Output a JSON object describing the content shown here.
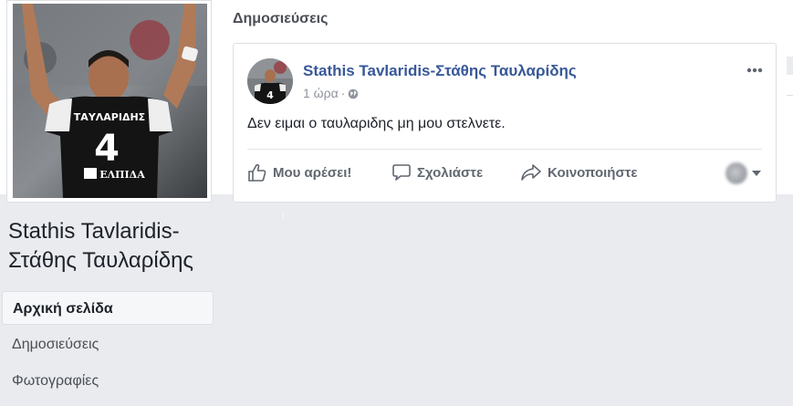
{
  "profile": {
    "name": "Stathis Tavlaridis-Στάθης Ταυλαρίδης",
    "jersey_name": "ΤΑΥΛΑΡΙΔΗΣ",
    "jersey_number": "4",
    "sponsor": "ΕΛΠΙΔΑ"
  },
  "nav": {
    "items": [
      {
        "label": "Αρχική σελίδα",
        "active": true
      },
      {
        "label": "Δημοσιεύσεις",
        "active": false
      },
      {
        "label": "Φωτογραφίες",
        "active": false
      }
    ]
  },
  "posts_section": {
    "title": "Δημοσιεύσεις"
  },
  "post": {
    "author": "Stathis Tavlaridis-Στάθης Ταυλαρίδης",
    "time": "1 ώρα",
    "separator": "·",
    "audience_icon": "globe-icon",
    "text": "Δεν ειμαι ο ταυλαριδης μη μου στελνετε.",
    "more_icon": "ellipsis-icon"
  },
  "actions": {
    "like": "Μου αρέσει!",
    "comment": "Σχολιάστε",
    "share": "Κοινοποιήστε"
  },
  "colors": {
    "link_blue": "#385898",
    "page_bg": "#e9ebee",
    "border": "#dddfe2",
    "secondary_text": "#90949c"
  }
}
